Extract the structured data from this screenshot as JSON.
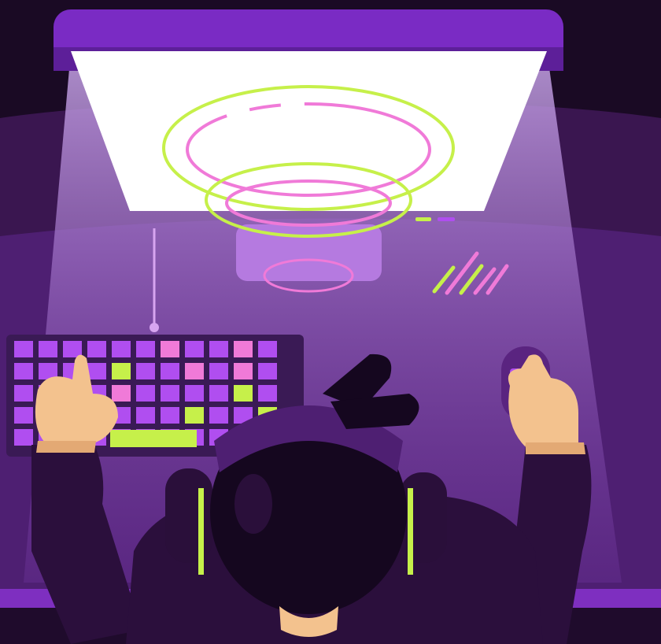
{
  "scene": {
    "description_name": "gamer-desk-illustration",
    "colors": {
      "background_dark": "#1a0a24",
      "background_band": "#3a1650",
      "desk_top": "#5a2480",
      "desk_edge": "#7e2fc0",
      "monitor_frame": "#7a2bc4",
      "monitor_screen": "#ffffff",
      "monitor_shadow": "#2a0f3a",
      "light_cone": "#b48ad8",
      "neon_green": "#c6f04a",
      "neon_pink": "#f07ad8",
      "neon_violet": "#b04ef0",
      "keyboard_base": "#3a1a55",
      "skin": "#f3c28e",
      "skin_shadow": "#e3a974",
      "hoodie": "#2b0f3c",
      "hair": "#15071f",
      "headphone": "#2a0f3a"
    }
  }
}
